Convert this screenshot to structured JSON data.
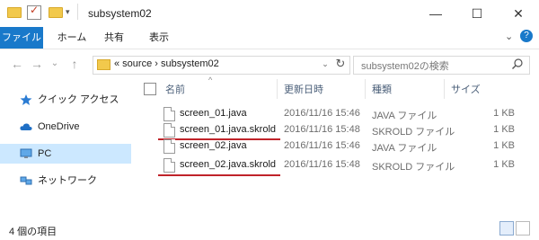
{
  "window": {
    "title": "subsystem02",
    "minimize": "—",
    "maximize": "☐",
    "close": "✕"
  },
  "ribbon": {
    "tabs": [
      "ファイル",
      "ホーム",
      "共有",
      "表示"
    ],
    "expand": "⌄",
    "help": "?"
  },
  "address": {
    "back": "←",
    "forward": "→",
    "recent": "⌄",
    "up": "↑",
    "path": "«  source  ›  subsystem02",
    "dropdown": "⌄",
    "refresh": "↻",
    "search_placeholder": "subsystem02の検索"
  },
  "navpane": {
    "items": [
      "クイック アクセス",
      "OneDrive",
      "PC",
      "ネットワーク"
    ],
    "selected": "PC"
  },
  "columns": {
    "name": "名前",
    "date": "更新日時",
    "type": "種類",
    "size": "サイズ",
    "sort_caret": "^"
  },
  "files": [
    {
      "name": "screen_01.java",
      "date": "2016/11/16 15:46",
      "type": "JAVA ファイル",
      "size": "1 KB"
    },
    {
      "name": "screen_01.java.skrold",
      "date": "2016/11/16 15:48",
      "type": "SKROLD ファイル",
      "size": "1 KB"
    },
    {
      "name": "screen_02.java",
      "date": "2016/11/16 15:46",
      "type": "JAVA ファイル",
      "size": "1 KB"
    },
    {
      "name": "screen_02.java.skrold",
      "date": "2016/11/16 15:48",
      "type": "SKROLD ファイル",
      "size": "1 KB"
    }
  ],
  "status": {
    "item_count": "4 個の項目"
  },
  "colors": {
    "accent": "#1979ca",
    "selection": "#cce8ff",
    "highlight_underline": "#c0232a"
  }
}
